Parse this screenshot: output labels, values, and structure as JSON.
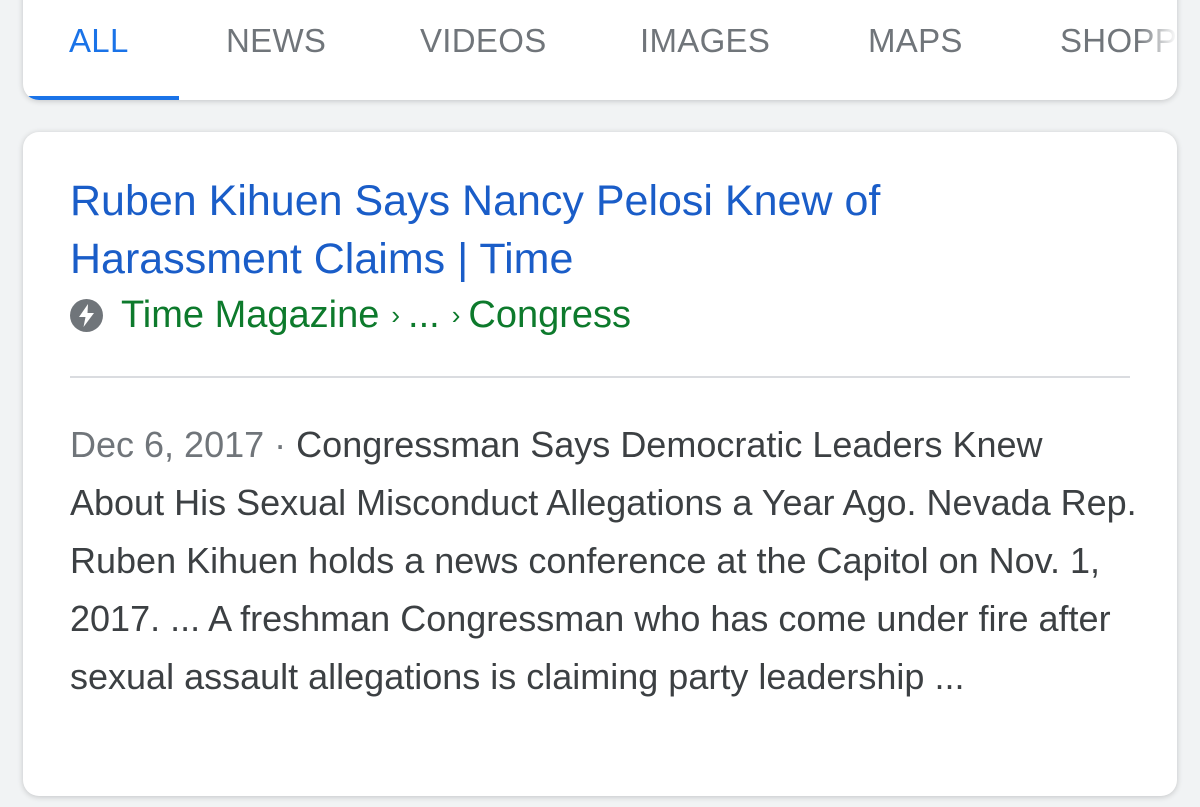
{
  "tabs": [
    {
      "label": "ALL",
      "active": true
    },
    {
      "label": "NEWS",
      "active": false
    },
    {
      "label": "VIDEOS",
      "active": false
    },
    {
      "label": "IMAGES",
      "active": false
    },
    {
      "label": "MAPS",
      "active": false
    },
    {
      "label": "SHOPP",
      "active": false
    }
  ],
  "result": {
    "title": "Ruben Kihuen Says Nancy Pelosi Knew of Harassment Claims | Time",
    "breadcrumb": {
      "site": "Time Magazine",
      "separator": "›",
      "middle": "...",
      "section": "Congress"
    },
    "snippet": {
      "date": "Dec 6, 2017",
      "separator": "·",
      "text": "Congressman Says Democratic Leaders Knew About His Sexual Misconduct Allegations a Year Ago. Nevada Rep. Ruben Kihuen holds a news conference at the Capitol on Nov. 1, 2017. ... A freshman Congressman who has come under fire after sexual assault allegations is claiming party leadership ..."
    }
  },
  "icons": {
    "amp": "amp-lightning-icon"
  },
  "colors": {
    "accent": "#1a73e8",
    "title_link": "#1a5dc8",
    "url_green": "#0d7a2c",
    "muted": "#70757a"
  }
}
